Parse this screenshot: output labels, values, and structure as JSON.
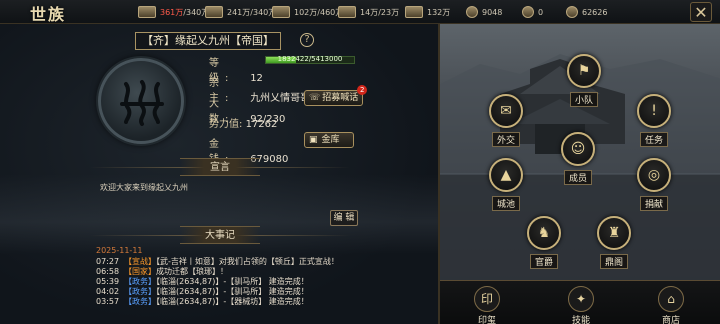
{
  "header": {
    "title": "世族",
    "resources": [
      {
        "icon": "food-icon",
        "value": "361万",
        "max": "/340万",
        "over": true
      },
      {
        "icon": "wood-icon",
        "value": "241万",
        "max": "/340万",
        "over": false
      },
      {
        "icon": "stone-icon",
        "value": "102万",
        "max": "/460万",
        "over": false
      },
      {
        "icon": "iron-icon",
        "value": "14万",
        "max": "/23万",
        "over": false
      },
      {
        "icon": "feather-icon",
        "value": "132万",
        "max": "",
        "over": false
      },
      {
        "icon": "coin-icon",
        "value": "9048",
        "max": "",
        "over": false
      },
      {
        "icon": "silver-icon",
        "value": "0",
        "max": "",
        "over": false
      },
      {
        "icon": "gold-icon",
        "value": "62626",
        "max": "",
        "over": false
      }
    ],
    "close_label": "✕"
  },
  "guild": {
    "name": "【齐】缘起乂九州【帝国】",
    "help": "?",
    "level_label": "等　级:",
    "level": "12",
    "exp_text": "1832422/5413000",
    "exp_fraction": 0.34,
    "leader_label": "宗　主:",
    "leader": "九州乂情哥哥",
    "members_label": "人　数:",
    "members": "92/230",
    "power_label": "势力值:",
    "power": "17262",
    "money_label": "金　钱:",
    "money": "679080",
    "recruit_label": "招募喊话",
    "recruit_badge": "2",
    "treasury_label": "金库"
  },
  "declaration": {
    "title": "宣言",
    "text": "欢迎大家来到缘起乂九州",
    "edit_label": "编 辑"
  },
  "events": {
    "title": "大事记",
    "date": "2025-11-11",
    "items": [
      {
        "time": "07:27",
        "tag": "【宣战】",
        "tag_color": "orange",
        "text": "【武-吉祥丨如意】对我们占领的【顿丘】正式宣战！"
      },
      {
        "time": "06:58",
        "tag": "【国家】",
        "tag_color": "orange",
        "text": "成功迁都【琅琊】！"
      },
      {
        "time": "05:39",
        "tag": "【政务】",
        "tag_color": "blue",
        "text": "【临淄(2634,87)】-【驯马所】 建造完成！"
      },
      {
        "time": "04:02",
        "tag": "【政务】",
        "tag_color": "blue",
        "text": "【临淄(2634,87)】-【驯马所】 建造完成！"
      },
      {
        "time": "03:57",
        "tag": "【政务】",
        "tag_color": "blue",
        "text": "【临淄(2634,87)】-【器械坊】 建造完成！"
      }
    ]
  },
  "functions": [
    {
      "name": "squad",
      "label": "小队",
      "icon": "flag-icon",
      "glyph": "⚑"
    },
    {
      "name": "diplomacy",
      "label": "外交",
      "icon": "scroll-icon",
      "glyph": "✉"
    },
    {
      "name": "mission",
      "label": "任务",
      "icon": "task-icon",
      "glyph": "!"
    },
    {
      "name": "members",
      "label": "成员",
      "icon": "members-icon",
      "glyph": "☺"
    },
    {
      "name": "city",
      "label": "城池",
      "icon": "city-icon",
      "glyph": "▲"
    },
    {
      "name": "donate",
      "label": "捐献",
      "icon": "donate-icon",
      "glyph": "◎"
    },
    {
      "name": "official",
      "label": "官爵",
      "icon": "official-icon",
      "glyph": "♞"
    },
    {
      "name": "pavilion",
      "label": "鼎阁",
      "icon": "pavilion-icon",
      "glyph": "♜"
    }
  ],
  "bottom": [
    {
      "name": "seal",
      "label": "印玺",
      "icon": "seal-icon",
      "glyph": "印"
    },
    {
      "name": "skill",
      "label": "技能",
      "icon": "skill-icon",
      "glyph": "✦"
    },
    {
      "name": "shop",
      "label": "商店",
      "icon": "shop-icon",
      "glyph": "⌂"
    }
  ]
}
